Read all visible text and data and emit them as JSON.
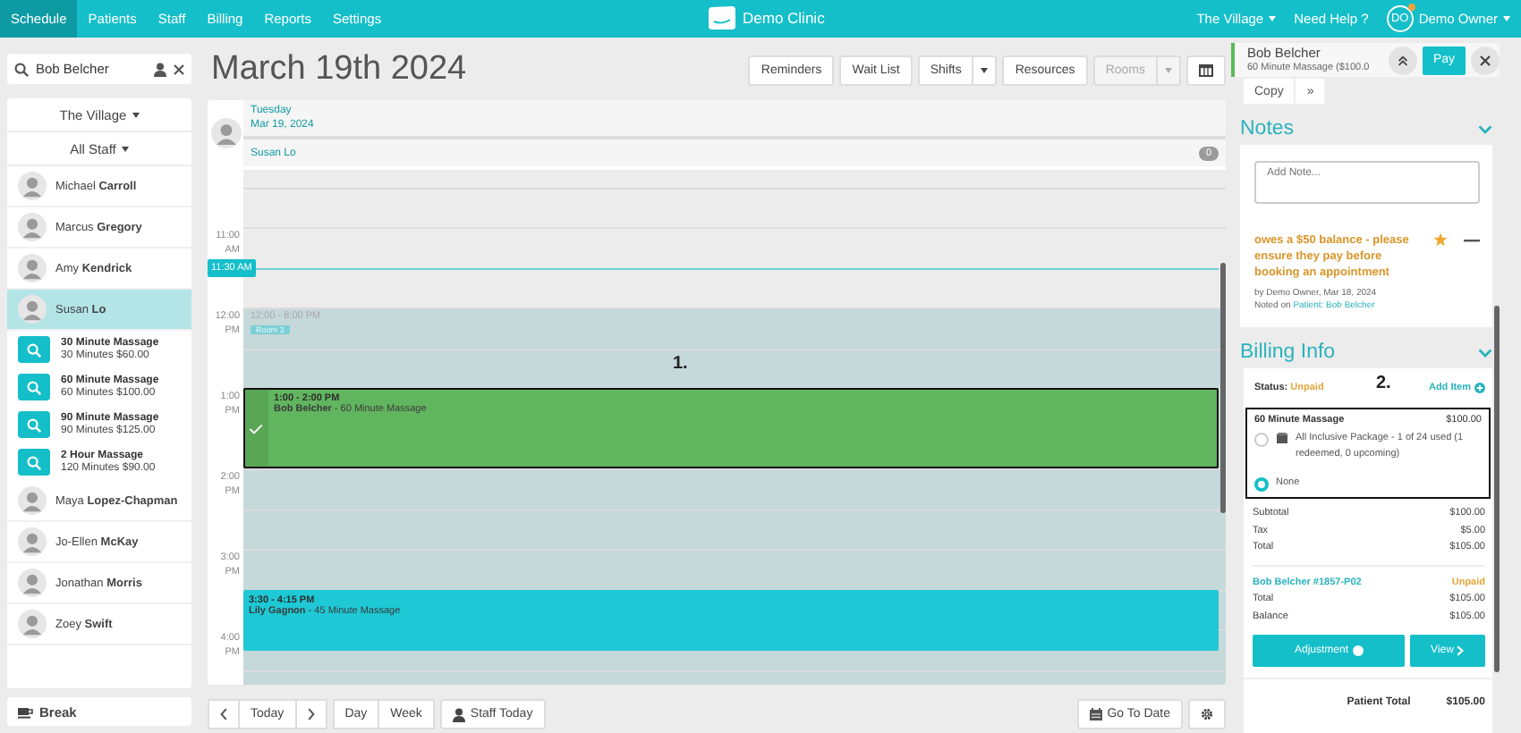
{
  "nav": {
    "items": [
      {
        "label": "Schedule",
        "selected": true
      },
      {
        "label": "Patients",
        "selected": false
      },
      {
        "label": "Staff",
        "selected": false
      },
      {
        "label": "Billing",
        "selected": false
      },
      {
        "label": "Reports",
        "selected": false
      },
      {
        "label": "Settings",
        "selected": false
      }
    ],
    "clinic": "Demo Clinic",
    "location": "The Village",
    "help": "Need Help ?",
    "user_initials": "DO",
    "user": "Demo Owner"
  },
  "sidebar": {
    "search": {
      "value": "Bob Belcher"
    },
    "location_filter": "The Village",
    "staff_filter": "All Staff",
    "staff": [
      {
        "name": "Michael **Carroll**",
        "selected": false
      },
      {
        "name": "Marcus **Gregory**",
        "selected": false
      },
      {
        "name": "Amy **Kendrick**",
        "selected": false
      },
      {
        "name": "Susan **Lo**",
        "selected": true,
        "services": [
          {
            "name": "30 Minute Massage",
            "detail": "30 Minutes $60.00"
          },
          {
            "name": "60 Minute Massage",
            "detail": "60 Minutes $100.00"
          },
          {
            "name": "90 Minute Massage",
            "detail": "90 Minutes $125.00"
          },
          {
            "name": "2 Hour Massage",
            "detail": "120 Minutes $90.00"
          }
        ]
      },
      {
        "name": "Maya **Lopez-Chapman**",
        "selected": false
      },
      {
        "name": "Jo-Ellen **McKay**",
        "selected": false
      },
      {
        "name": "Jonathan **Morris**",
        "selected": false
      },
      {
        "name": "Zoey **Swift**",
        "selected": false
      }
    ],
    "break_button": "Break"
  },
  "schedule": {
    "title": "March 19th 2024",
    "toolbar": [
      {
        "kind": "button",
        "label": "Reminders",
        "disabled": false
      },
      {
        "kind": "button",
        "label": "Wait List",
        "disabled": false
      },
      {
        "kind": "split",
        "label": "Shifts",
        "disabled": false
      },
      {
        "kind": "button",
        "label": "Resources",
        "disabled": false
      },
      {
        "kind": "split",
        "label": "Rooms",
        "disabled": true
      },
      {
        "kind": "icon"
      }
    ],
    "calendar": {
      "weekday": "Tuesday",
      "date": "Mar 19, 2024",
      "staff": "Susan Lo",
      "count": "0",
      "hours": [
        {
          "time": "11:00",
          "period": "AM"
        },
        {
          "time": "12:00",
          "period": "PM"
        },
        {
          "time": "1:00",
          "period": "PM"
        },
        {
          "time": "2:00",
          "period": "PM"
        },
        {
          "time": "3:00",
          "period": "PM"
        },
        {
          "time": "4:00",
          "period": "PM"
        }
      ],
      "now": "11:30 AM",
      "availability": {
        "time": "12:00 - 8:00 PM",
        "room": "Room 3"
      },
      "appointments": [
        {
          "time": "1:00 - 2:00 PM",
          "description": "**Bob Belcher** - 60 Minute Massage",
          "color": "#62b55f",
          "checked": true,
          "selected": true
        },
        {
          "time": "3:30 - 4:15 PM",
          "description": "**Lily Gagnon** - 45 Minute Massage",
          "color": "#1ec8d4",
          "checked": false,
          "selected": false
        }
      ],
      "annotation": "1."
    },
    "footer": {
      "today": "Today",
      "views": [
        "Day",
        "Week"
      ],
      "staff_today": "Staff Today",
      "go_to_date": "Go To Date"
    }
  },
  "panel": {
    "appointment": {
      "patient": "Bob Belcher",
      "detail": "60 Minute Massage ($100.0",
      "pay": "Pay",
      "copy": "Copy",
      "more": "»"
    },
    "notes": {
      "title": "Notes",
      "placeholder": "Add Note...",
      "note": "owes a $50 balance - please ensure they pay before booking an appointment",
      "starred": true,
      "meta": "by Demo Owner, Mar 18, 2024",
      "noted_on": "Noted on",
      "link": "Patient: Bob Belcher"
    },
    "billing": {
      "title": "Billing Info",
      "status_label": "Status:",
      "status": "Unpaid",
      "annotation": "2.",
      "add_item": "Add Item",
      "item": {
        "name": "60 Minute Massage",
        "price": "$100.00",
        "options": [
          {
            "label": "All Inclusive Package - 1 of 24 used (1 redeemed, 0 upcoming)",
            "selected": false
          },
          {
            "label": "None",
            "selected": true
          }
        ]
      },
      "totals": [
        {
          "label": "Subtotal",
          "value": "$100.00"
        },
        {
          "label": "Tax",
          "value": "$5.00"
        },
        {
          "label": "Total",
          "value": "$105.00"
        }
      ],
      "invoice": {
        "name": "Bob Belcher #1857-P02",
        "status": "Unpaid",
        "rows": [
          {
            "label": "Total",
            "value": "$105.00"
          },
          {
            "label": "Balance",
            "value": "$105.00"
          }
        ]
      },
      "adjustment": "Adjustment",
      "view": "View",
      "patient_total_label": "Patient Total",
      "patient_total": "$105.00"
    }
  }
}
